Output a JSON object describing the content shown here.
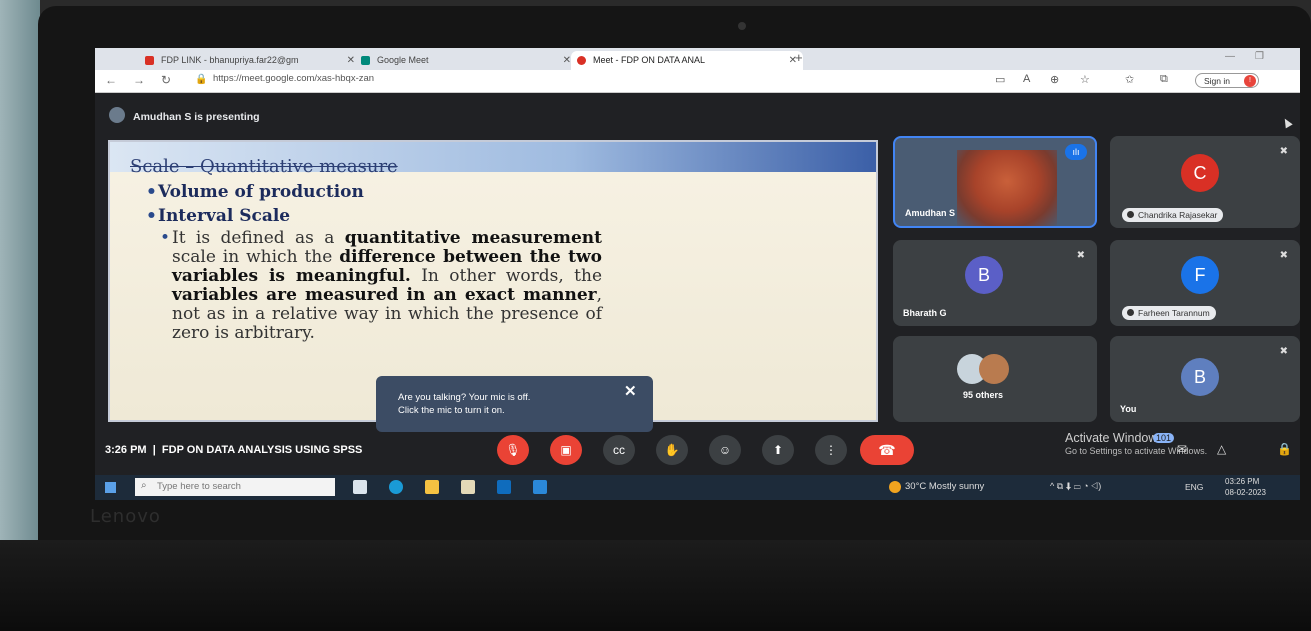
{
  "browser": {
    "tabs": [
      {
        "label": "FDP LINK - bhanupriya.far22@gm",
        "active": false
      },
      {
        "label": "Google Meet",
        "active": false
      },
      {
        "label": "Meet - FDP ON DATA ANAL",
        "active": true
      }
    ],
    "url": "https://meet.google.com/xas-hbqx-zan",
    "signin_label": "Sign in"
  },
  "meet": {
    "presenting_text": "Amudhan S is presenting",
    "slide": {
      "title": "Scale – Quantitative measure",
      "bullets": [
        "Volume of production",
        "Interval Scale"
      ],
      "body_parts": [
        {
          "text": "It is defined as a ",
          "bold": false
        },
        {
          "text": "quantitative measurement",
          "bold": true
        },
        {
          "text": " scale in which the ",
          "bold": false
        },
        {
          "text": "difference between the two variables is meaningful.",
          "bold": true
        },
        {
          "text": " In other words, the ",
          "bold": false
        },
        {
          "text": "variables are measured in an exact manner",
          "bold": true
        },
        {
          "text": ", not as in a relative way in which the presence of zero is arbitrary.",
          "bold": false
        }
      ]
    },
    "toast": {
      "line1": "Are you talking? Your mic is off.",
      "line2": "Click the mic to turn it on."
    },
    "participants": [
      {
        "name": "Amudhan S",
        "speaking": true,
        "video": true
      },
      {
        "name": "Chandrika Rajasekar",
        "initial": "C",
        "color": "#d93025",
        "muted": true
      },
      {
        "name": "Bharath G",
        "initial": "B",
        "color": "#5b5fc7",
        "muted": true
      },
      {
        "name": "Farheen Tarannum",
        "initial": "F",
        "color": "#1a73e8",
        "muted": true
      },
      {
        "name": "95 others"
      },
      {
        "name": "You",
        "initial": "B",
        "color": "#5f7fbf",
        "muted": true
      }
    ],
    "time": "3:26 PM",
    "meeting_title": "FDP ON DATA ANALYSIS USING SPSS",
    "people_count": "101"
  },
  "windows": {
    "activate_title": "Activate Windows",
    "activate_sub": "Go to Settings to activate Windows.",
    "search_placeholder": "Type here to search",
    "weather": "30°C  Mostly sunny",
    "language": "ENG",
    "clock_time": "03:26 PM",
    "clock_date": "08-02-2023"
  },
  "device": {
    "brand": "Lenovo"
  }
}
